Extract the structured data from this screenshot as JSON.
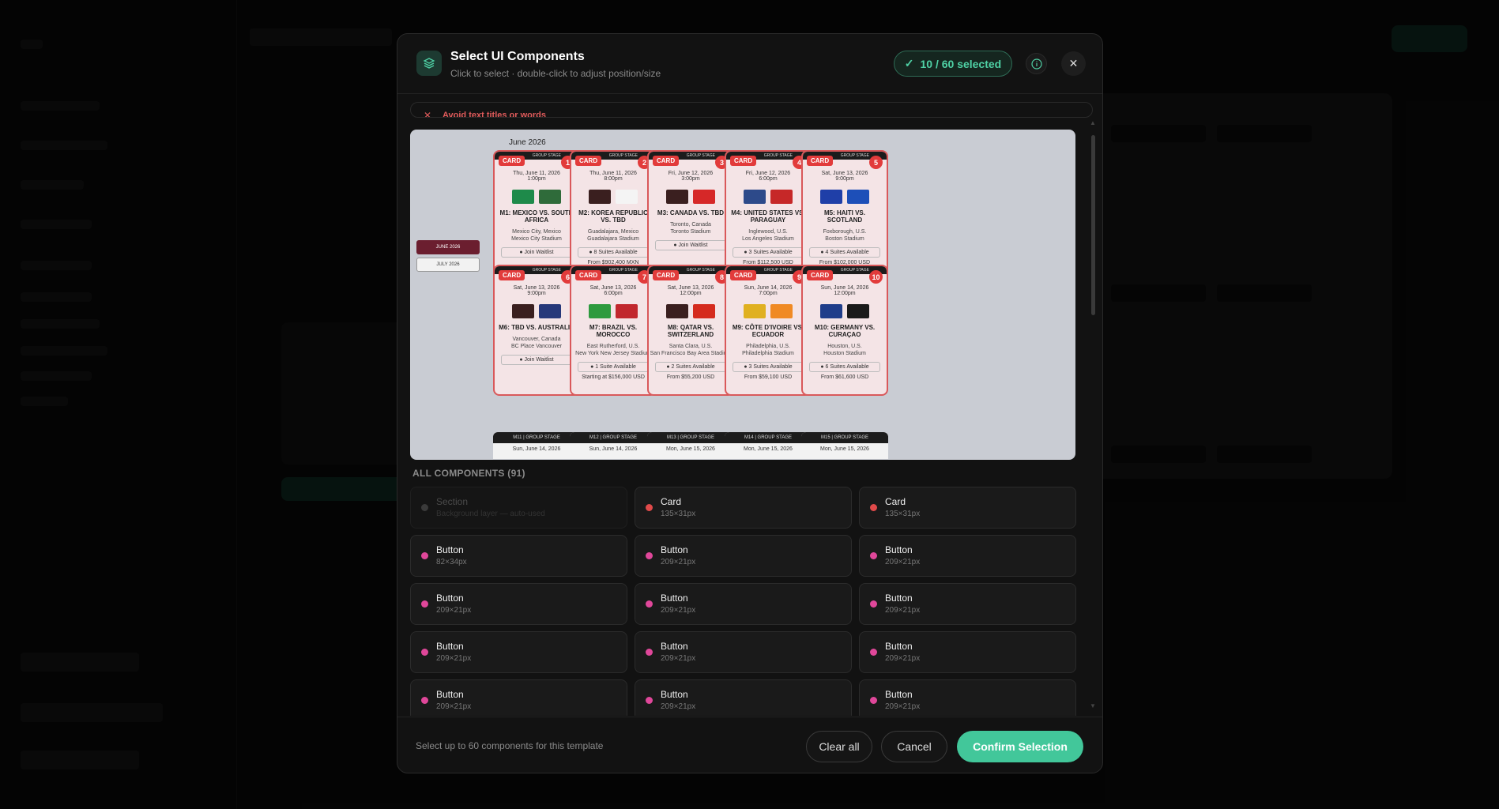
{
  "modal": {
    "title": "Select UI Components",
    "subtitle": "Click to select · double-click to adjust position/size",
    "selected_badge": "10 / 60 selected",
    "warning_text": "Avoid text titles or words",
    "close_glyph": "✕",
    "check_glyph": "✓"
  },
  "preview": {
    "month_label": "June 2026",
    "side_buttons": [
      "JUNE 2026",
      "JULY 2026"
    ],
    "cards": [
      {
        "tag": "CARD",
        "num": "1",
        "stage": "GROUP STAGE",
        "date": "Thu, June 11, 2026",
        "time": "1:00pm",
        "match": "M1: MEXICO VS. SOUTH AFRICA",
        "loc1": "Mexico City, Mexico",
        "loc2": "Mexico City Stadium",
        "pill": "● Join Waitlist",
        "from": "",
        "flag1": "#1e8a4a",
        "flag2": "#2f6b3a"
      },
      {
        "tag": "CARD",
        "num": "2",
        "stage": "GROUP STAGE",
        "date": "Thu, June 11, 2026",
        "time": "8:00pm",
        "match": "M2: KOREA REPUBLIC VS. TBD",
        "loc1": "Guadalajara, Mexico",
        "loc2": "Guadalajara Stadium",
        "pill": "● 8 Suites Available",
        "from": "From $902,400 MXN",
        "flag1": "#3a1f1f",
        "flag2": "#f4f4f4"
      },
      {
        "tag": "CARD",
        "num": "3",
        "stage": "GROUP STAGE",
        "date": "Fri, June 12, 2026",
        "time": "3:00pm",
        "match": "M3: CANADA VS. TBD",
        "loc1": "Toronto, Canada",
        "loc2": "Toronto Stadium",
        "pill": "● Join Waitlist",
        "from": "",
        "flag1": "#3a1f1f",
        "flag2": "#d62828"
      },
      {
        "tag": "CARD",
        "num": "4",
        "stage": "GROUP STAGE",
        "date": "Fri, June 12, 2026",
        "time": "6:00pm",
        "match": "M4: UNITED STATES VS. PARAGUAY",
        "loc1": "Inglewood, U.S.",
        "loc2": "Los Angeles Stadium",
        "pill": "● 3 Suites Available",
        "from": "From $112,500 USD",
        "flag1": "#2d4a8a",
        "flag2": "#c62828"
      },
      {
        "tag": "CARD",
        "num": "5",
        "stage": "GROUP STAGE",
        "date": "Sat, June 13, 2026",
        "time": "9:00pm",
        "match": "M5: HAITI VS. SCOTLAND",
        "loc1": "Foxborough, U.S.",
        "loc2": "Boston Stadium",
        "pill": "● 4 Suites Available",
        "from": "From $102,000 USD",
        "flag1": "#1f3fa8",
        "flag2": "#1d4fb8"
      },
      {
        "tag": "CARD",
        "num": "6",
        "stage": "GROUP STAGE",
        "date": "Sat, June 13, 2026",
        "time": "9:00pm",
        "match": "M6: TBD VS. AUSTRALIA",
        "loc1": "Vancouver, Canada",
        "loc2": "BC Place Vancouver",
        "pill": "● Join Waitlist",
        "from": "",
        "flag1": "#3a1f1f",
        "flag2": "#26387a"
      },
      {
        "tag": "CARD",
        "num": "7",
        "stage": "GROUP STAGE",
        "date": "Sat, June 13, 2026",
        "time": "6:00pm",
        "match": "M7: BRAZIL VS. MOROCCO",
        "loc1": "East Rutherford, U.S.",
        "loc2": "New York New Jersey Stadium",
        "pill": "● 1 Suite Available",
        "from": "Starting at $156,000 USD",
        "flag1": "#2e9a3e",
        "flag2": "#c1272d"
      },
      {
        "tag": "CARD",
        "num": "8",
        "stage": "GROUP STAGE",
        "date": "Sat, June 13, 2026",
        "time": "12:00pm",
        "match": "M8: QATAR VS. SWITZERLAND",
        "loc1": "Santa Clara, U.S.",
        "loc2": "San Francisco Bay Area Stadium",
        "pill": "● 2 Suites Available",
        "from": "From $55,200 USD",
        "flag1": "#3a1f1f",
        "flag2": "#d52b1e"
      },
      {
        "tag": "CARD",
        "num": "9",
        "stage": "GROUP STAGE",
        "date": "Sun, June 14, 2026",
        "time": "7:00pm",
        "match": "M9: CÔTE D'IVOIRE VS. ECUADOR",
        "loc1": "Philadelphia, U.S.",
        "loc2": "Philadelphia Stadium",
        "pill": "● 3 Suites Available",
        "from": "From $59,100 USD",
        "flag1": "#e0b020",
        "flag2": "#f08a24"
      },
      {
        "tag": "CARD",
        "num": "10",
        "stage": "GROUP STAGE",
        "date": "Sun, June 14, 2026",
        "time": "12:00pm",
        "match": "M10: GERMANY VS. CURAÇAO",
        "loc1": "Houston, U.S.",
        "loc2": "Houston Stadium",
        "pill": "● 6 Suites Available",
        "from": "From $61,600 USD",
        "flag1": "#1f3d8a",
        "flag2": "#1a1a1a"
      }
    ],
    "mini_cards": [
      {
        "bar": "M11 | GROUP STAGE",
        "date": "Sun, June 14, 2026"
      },
      {
        "bar": "M12 | GROUP STAGE",
        "date": "Sun, June 14, 2026"
      },
      {
        "bar": "M13 | GROUP STAGE",
        "date": "Mon, June 15, 2026"
      },
      {
        "bar": "M14 | GROUP STAGE",
        "date": "Mon, June 15, 2026"
      },
      {
        "bar": "M15 | GROUP STAGE",
        "date": "Mon, June 15, 2026"
      }
    ]
  },
  "components": {
    "label": "ALL COMPONENTS (91)",
    "items": [
      {
        "name": "Section",
        "dim": "Background layer — auto-used",
        "color": "#3a3a3a",
        "disabled": true
      },
      {
        "name": "Card",
        "dim": "135×31px",
        "color": "#e04a4a"
      },
      {
        "name": "Card",
        "dim": "135×31px",
        "color": "#e04a4a"
      },
      {
        "name": "Button",
        "dim": "82×34px",
        "color": "#e0479a"
      },
      {
        "name": "Button",
        "dim": "209×21px",
        "color": "#e0479a"
      },
      {
        "name": "Button",
        "dim": "209×21px",
        "color": "#e0479a"
      },
      {
        "name": "Button",
        "dim": "209×21px",
        "color": "#e0479a"
      },
      {
        "name": "Button",
        "dim": "209×21px",
        "color": "#e0479a"
      },
      {
        "name": "Button",
        "dim": "209×21px",
        "color": "#e0479a"
      },
      {
        "name": "Button",
        "dim": "209×21px",
        "color": "#e0479a"
      },
      {
        "name": "Button",
        "dim": "209×21px",
        "color": "#e0479a"
      },
      {
        "name": "Button",
        "dim": "209×21px",
        "color": "#e0479a"
      },
      {
        "name": "Button",
        "dim": "209×21px",
        "color": "#e0479a"
      },
      {
        "name": "Button",
        "dim": "209×21px",
        "color": "#e0479a"
      },
      {
        "name": "Button",
        "dim": "209×21px",
        "color": "#e0479a"
      }
    ]
  },
  "footer": {
    "note": "Select up to 60 components for this template",
    "clear_label": "Clear all",
    "cancel_label": "Cancel",
    "confirm_label": "Confirm Selection"
  },
  "colors": {
    "accent": "#42c79a",
    "danger": "#e04a4a"
  }
}
